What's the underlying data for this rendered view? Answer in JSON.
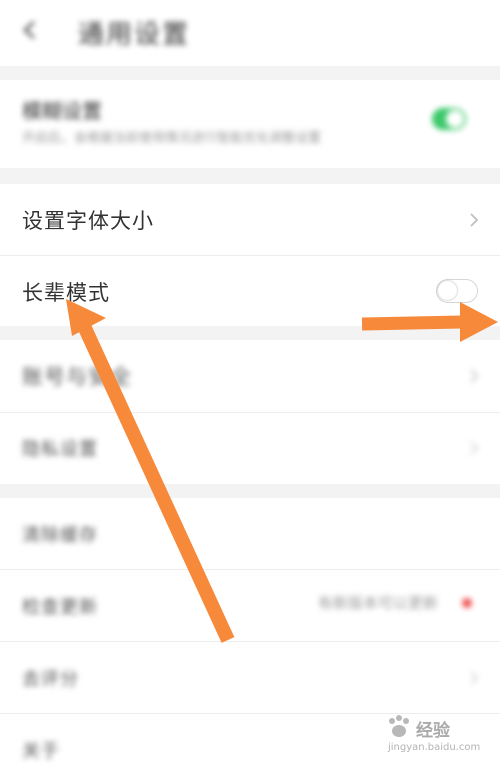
{
  "header": {
    "title": "通用设置"
  },
  "top_section": {
    "title": "模糊设置",
    "description": "开启后，会根据当前使用情况进行智能优化调整设置",
    "toggle_on": true
  },
  "settings": {
    "font_size_label": "设置字体大小",
    "elder_mode_label": "长辈模式",
    "elder_mode_on": false
  },
  "section_two": {
    "account_label": "账号与安全",
    "privacy_label": "隐私设置"
  },
  "section_three": {
    "item1": "清除缓存",
    "item2": "检查更新",
    "item2_status": "有新版本可以更新",
    "item3": "去评分",
    "item4": "关于"
  },
  "watermark": {
    "text": "经验",
    "url": "jingyan.baidu.com"
  },
  "colors": {
    "accent_green": "#3bc86a",
    "annotation_arrow": "#f7893a",
    "badge_red": "#f05050"
  }
}
